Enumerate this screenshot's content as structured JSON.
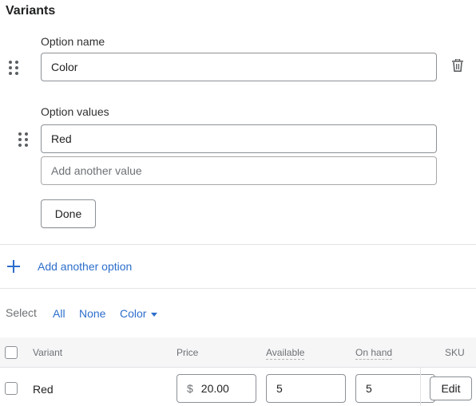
{
  "section": {
    "title": "Variants"
  },
  "option": {
    "name_label": "Option name",
    "name_value": "Color",
    "values_label": "Option values",
    "values": [
      "Red"
    ],
    "add_value_placeholder": "Add another value",
    "done_label": "Done"
  },
  "add_option_label": "Add another option",
  "select_bar": {
    "label": "Select",
    "all": "All",
    "none": "None",
    "color": "Color"
  },
  "table": {
    "headers": {
      "variant": "Variant",
      "price": "Price",
      "available": "Available",
      "on_hand": "On hand",
      "sku": "SKU"
    },
    "rows": [
      {
        "variant": "Red",
        "currency": "$",
        "price": "20.00",
        "available": "5",
        "on_hand": "5",
        "edit": "Edit"
      }
    ]
  },
  "colors": {
    "link": "#2c6ecb",
    "border": "#8c9196",
    "divider": "#e1e3e5"
  }
}
